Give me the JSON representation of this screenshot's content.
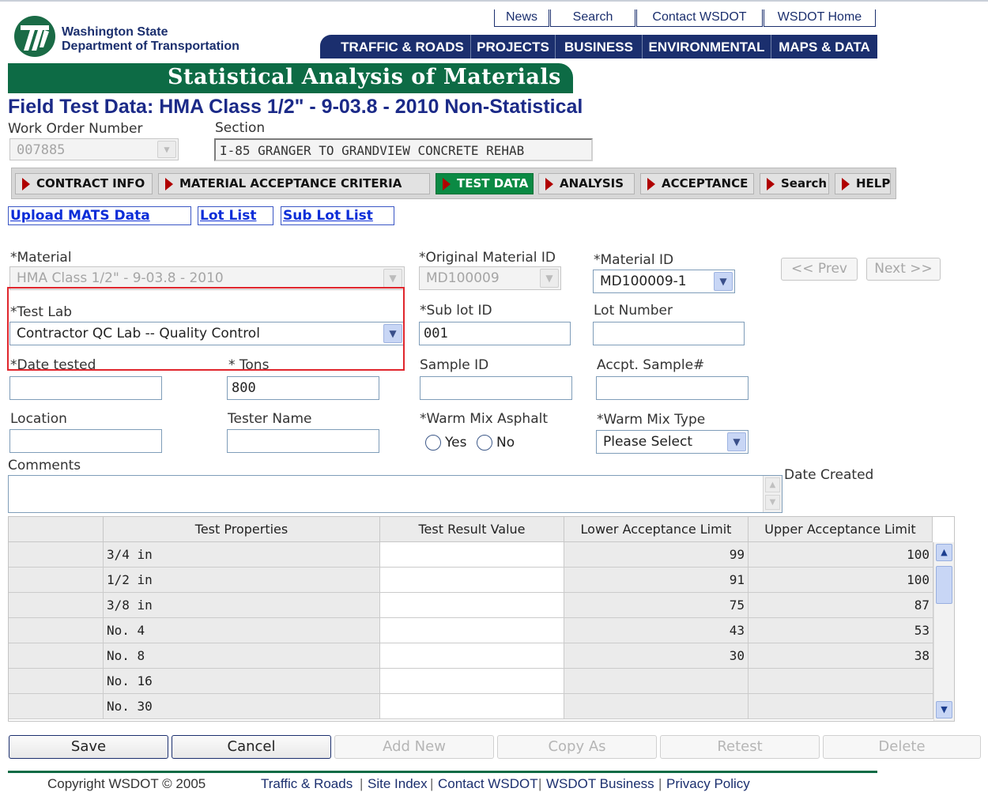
{
  "header": {
    "org_line1": "Washington State",
    "org_line2": "Department of Transportation",
    "util_links": [
      "News",
      "Search",
      "Contact WSDOT",
      "WSDOT Home"
    ],
    "nav": [
      "TRAFFIC & ROADS",
      "PROJECTS",
      "BUSINESS",
      "ENVIRONMENTAL",
      "MAPS & DATA"
    ],
    "banner": "Statistical Analysis of Materials",
    "brand_color": "#0d6b45",
    "nav_color": "#1b2f6e"
  },
  "page_title": "Field Test Data: HMA Class 1/2\" - 9-03.8 - 2010 Non-Statistical",
  "work_order": {
    "label": "Work Order Number",
    "value": "007885"
  },
  "section": {
    "label": "Section",
    "value": "I-85 GRANGER TO GRANDVIEW CONCRETE REHAB"
  },
  "tabs": [
    "CONTRACT INFO",
    "MATERIAL ACCEPTANCE CRITERIA",
    "TEST DATA",
    "ANALYSIS",
    "ACCEPTANCE",
    "Search",
    "HELP"
  ],
  "active_tab": "TEST DATA",
  "links": [
    "Upload MATS Data",
    "Lot List",
    "Sub Lot List"
  ],
  "form": {
    "material": {
      "label": "*Material",
      "value": "HMA Class 1/2\" - 9-03.8 - 2010"
    },
    "original_material_id": {
      "label": "*Original Material ID",
      "value": "MD100009"
    },
    "material_id": {
      "label": "*Material ID",
      "value": "MD100009-1"
    },
    "prev": "<< Prev",
    "next": "Next >>",
    "test_lab": {
      "label": "*Test Lab",
      "value": "Contractor QC Lab -- Quality Control"
    },
    "sub_lot_id": {
      "label": "*Sub lot ID",
      "value": "001"
    },
    "lot_number": {
      "label": "Lot Number",
      "value": ""
    },
    "date_tested": {
      "label": "*Date tested",
      "value": ""
    },
    "tons": {
      "label": "* Tons",
      "value": "800"
    },
    "sample_id": {
      "label": "Sample ID",
      "value": ""
    },
    "accpt_sample": {
      "label": "Accpt. Sample#",
      "value": ""
    },
    "location": {
      "label": "Location",
      "value": ""
    },
    "tester_name": {
      "label": "Tester Name",
      "value": ""
    },
    "warm_mix_asphalt": {
      "label": "*Warm Mix Asphalt",
      "yes": "Yes",
      "no": "No"
    },
    "warm_mix_type": {
      "label": "*Warm Mix Type",
      "value": "Please Select"
    },
    "comments": {
      "label": "Comments",
      "value": ""
    },
    "date_created": {
      "label": "Date Created"
    }
  },
  "grid": {
    "columns": [
      "Test Properties",
      "Test Result Value",
      "Lower Acceptance Limit",
      "Upper Acceptance Limit"
    ],
    "rows": [
      {
        "property": "3/4 in",
        "result": "",
        "lower": "99",
        "upper": "100"
      },
      {
        "property": "1/2 in",
        "result": "",
        "lower": "91",
        "upper": "100"
      },
      {
        "property": "3/8 in",
        "result": "",
        "lower": "75",
        "upper": "87"
      },
      {
        "property": "No. 4",
        "result": "",
        "lower": "43",
        "upper": "53"
      },
      {
        "property": "No. 8",
        "result": "",
        "lower": "30",
        "upper": "38"
      },
      {
        "property": "No. 16",
        "result": "",
        "lower": "",
        "upper": ""
      },
      {
        "property": "No. 30",
        "result": "",
        "lower": "",
        "upper": ""
      }
    ]
  },
  "actions": [
    "Save",
    "Cancel",
    "Add New",
    "Copy As",
    "Retest",
    "Delete"
  ],
  "footer": {
    "copyright": "Copyright WSDOT © 2005",
    "links": [
      "Traffic & Roads",
      "Site Index",
      "Contact WSDOT",
      "WSDOT Business",
      "Privacy Policy"
    ]
  }
}
